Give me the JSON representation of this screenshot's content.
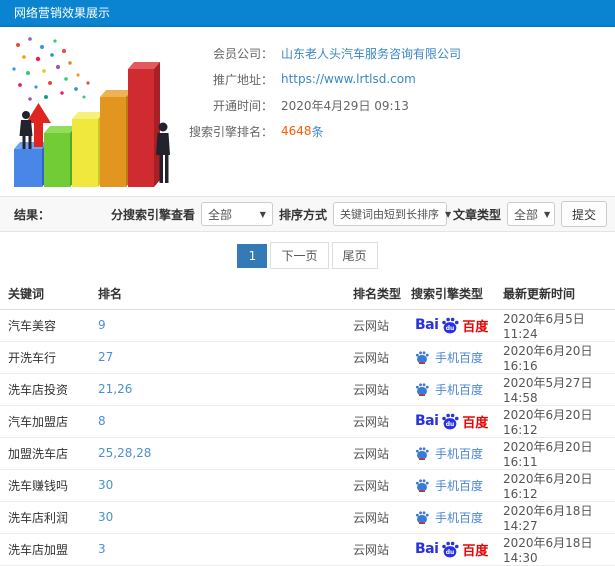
{
  "header": {
    "title": "网络营销效果展示"
  },
  "info": {
    "fields": [
      {
        "label": "会员公司：",
        "value": "山东老人头汽车服务咨询有限公司"
      },
      {
        "label": "推广地址：",
        "value": "https://www.lrtlsd.com"
      },
      {
        "label": "开通时间：",
        "value": "2020年4月29日 09:13"
      },
      {
        "label": "搜索引擎排名：",
        "value": "4648",
        "suffix": "条"
      }
    ]
  },
  "filters": {
    "section_label": "结果：",
    "engine_label": "分搜索引擎查看",
    "engine_value": "全部",
    "sort_label": "排序方式",
    "sort_value": "关键词由短到长排序",
    "article_label": "文章类型",
    "article_value": "全部",
    "submit_label": "提交",
    "caret": "▼"
  },
  "pagination": {
    "current": "1",
    "next": "下一页",
    "last": "尾页"
  },
  "logos": {
    "baidu": {
      "prefix": "Bai",
      "paw_text": "du",
      "suffix": "百度"
    },
    "mobile_baidu": {
      "label": "手机百度"
    }
  },
  "table": {
    "headers": [
      "关键词",
      "排名",
      "排名类型",
      "搜索引擎类型",
      "最新更新时间"
    ],
    "rows": [
      {
        "keyword": "汽车美容",
        "rank": "9",
        "rank_type": "云网站",
        "engine": "baidu",
        "updated": "2020年6月5日 11:24"
      },
      {
        "keyword": "开洗车行",
        "rank": "27",
        "rank_type": "云网站",
        "engine": "mobile_baidu",
        "updated": "2020年6月20日 16:16"
      },
      {
        "keyword": "洗车店投资",
        "rank": "21,26",
        "rank_type": "云网站",
        "engine": "mobile_baidu",
        "updated": "2020年5月27日 14:58"
      },
      {
        "keyword": "汽车加盟店",
        "rank": "8",
        "rank_type": "云网站",
        "engine": "baidu",
        "updated": "2020年6月20日 16:12"
      },
      {
        "keyword": "加盟洗车店",
        "rank": "25,28,28",
        "rank_type": "云网站",
        "engine": "mobile_baidu",
        "updated": "2020年6月20日 16:11"
      },
      {
        "keyword": "洗车赚钱吗",
        "rank": "30",
        "rank_type": "云网站",
        "engine": "mobile_baidu",
        "updated": "2020年6月20日 16:12"
      },
      {
        "keyword": "洗车店利润",
        "rank": "30",
        "rank_type": "云网站",
        "engine": "mobile_baidu",
        "updated": "2020年6月18日 14:27"
      },
      {
        "keyword": "洗车店加盟",
        "rank": "3",
        "rank_type": "云网站",
        "engine": "baidu",
        "updated": "2020年6月18日 14:30"
      }
    ]
  },
  "colors": {
    "header_bg": "#0a84d0",
    "link": "#3a87c8",
    "highlight": "#ff5a00",
    "active_page": "#337ab7",
    "baidu_blue": "#2932e1",
    "baidu_red": "#e10602",
    "mobile_baidu_blue": "#4b86d8"
  }
}
